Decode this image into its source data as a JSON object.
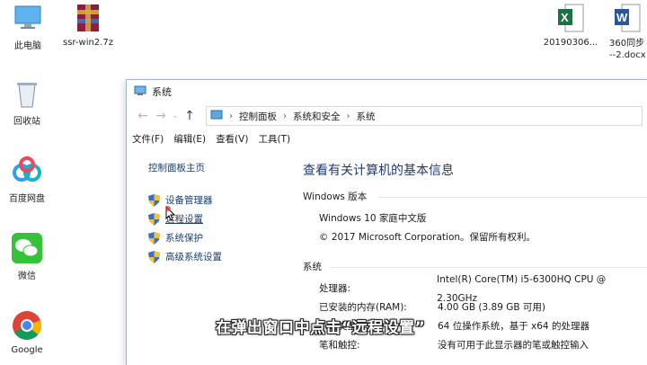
{
  "desktop": {
    "icons": [
      {
        "label": "此电脑"
      },
      {
        "label": "ssr-win2.7z"
      },
      {
        "label": "回收站"
      },
      {
        "label": "百度网盘"
      },
      {
        "label": "微信"
      },
      {
        "label": "Google"
      },
      {
        "label": "20190306..."
      },
      {
        "label": "360同步\n--2.docx"
      }
    ]
  },
  "window": {
    "title": "系统",
    "breadcrumb": [
      "控制面板",
      "系统和安全",
      "系统"
    ],
    "menu": [
      "文件(F)",
      "编辑(E)",
      "查看(V)",
      "工具(T)"
    ],
    "sidebar": {
      "home": "控制面板主页",
      "items": [
        "设备管理器",
        "远程设置",
        "系统保护",
        "高级系统设置"
      ]
    },
    "main": {
      "heading": "查看有关计算机的基本信息",
      "edition_section": "Windows 版本",
      "edition": "Windows 10 家庭中文版",
      "copyright": "© 2017 Microsoft Corporation。保留所有权利。",
      "system_section": "系统",
      "specs": [
        {
          "key": "处理器:",
          "value": "Intel(R) Core(TM) i5-6300HQ CPU @ 2.30GHz"
        },
        {
          "key": "已安装的内存(RAM):",
          "value": "4.00 GB (3.89 GB 可用)"
        },
        {
          "key": "系统类型:",
          "value": "64 位操作系统，基于 x64 的处理器"
        },
        {
          "key": "笔和触控:",
          "value": "没有可用于此显示器的笔或触控输入"
        }
      ]
    }
  },
  "subtitle": "在弹出窗口中点击“远程设置”",
  "colors": {
    "link": "#1a3e6e",
    "heading": "#1e3a6e"
  }
}
